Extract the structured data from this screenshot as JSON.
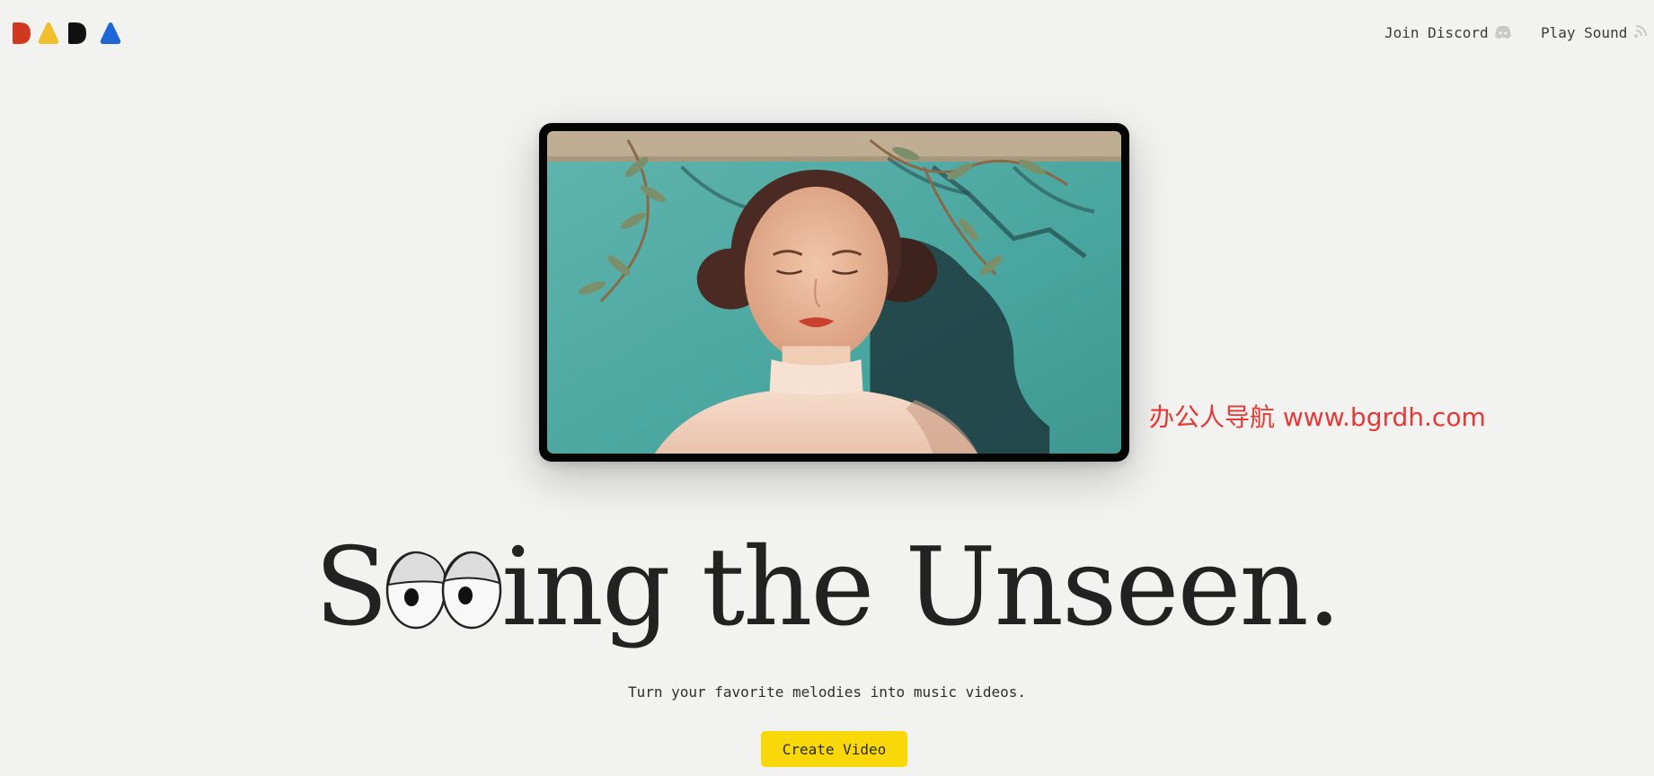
{
  "brand": {
    "logo_name": "DADA",
    "logo_colors": [
      "#d0391f",
      "#f0bf2e",
      "#111111",
      "#1f67d6"
    ]
  },
  "nav": {
    "discord_label": "Join Discord",
    "sound_label": "Play Sound",
    "discord_icon": "discord-icon",
    "sound_icon": "sound-icon"
  },
  "hero": {
    "video_preview": "music-video-preview",
    "headline_prefix": "S",
    "headline_suffix": "ing the Unseen.",
    "headline_eyes_icon": "cartoon-eyes-icon",
    "subtitle": "Turn your favorite melodies into music videos.",
    "cta_label": "Create Video",
    "cta_color": "#f8d808"
  },
  "watermark": {
    "text": "办公人导航 www.bgrdh.com",
    "color": "#e53935"
  }
}
